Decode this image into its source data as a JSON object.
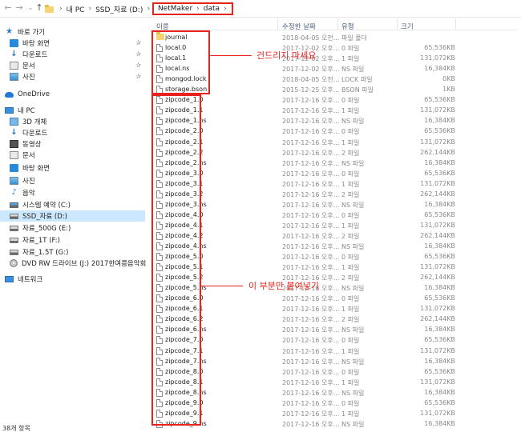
{
  "address_bar": {
    "back_icon": "back-arrow-icon",
    "forward_icon": "forward-arrow-icon",
    "up_icon": "up-arrow-icon",
    "crumbs": [
      "내 PC",
      "SSD_자료 (D:)",
      "NetMaker",
      "data"
    ]
  },
  "sidebar": {
    "items": [
      {
        "label": "바로 가기",
        "icon": "star-icon"
      },
      {
        "label": "바탕 화면",
        "icon": "desktop-icon",
        "pinned": true
      },
      {
        "label": "다운로드",
        "icon": "download-icon",
        "pinned": true
      },
      {
        "label": "문서",
        "icon": "document-icon",
        "pinned": true
      },
      {
        "label": "사진",
        "icon": "pictures-icon",
        "pinned": true
      },
      {
        "label": "OneDrive",
        "icon": "onedrive-icon"
      },
      {
        "label": "내 PC",
        "icon": "pc-icon"
      },
      {
        "label": "3D 개체",
        "icon": "3d-objects-icon"
      },
      {
        "label": "다운로드",
        "icon": "download-icon"
      },
      {
        "label": "동영상",
        "icon": "video-icon"
      },
      {
        "label": "문서",
        "icon": "document-icon"
      },
      {
        "label": "바탕 화면",
        "icon": "desktop-icon"
      },
      {
        "label": "사진",
        "icon": "pictures-icon"
      },
      {
        "label": "음악",
        "icon": "music-icon"
      },
      {
        "label": "시스템 예약 (C:)",
        "icon": "drive-icon"
      },
      {
        "label": "SSD_자료 (D:)",
        "icon": "drive-icon",
        "selected": true
      },
      {
        "label": "자료_500G (E:)",
        "icon": "drive-icon"
      },
      {
        "label": "자료_1T (F:)",
        "icon": "drive-icon"
      },
      {
        "label": "자료_1.5T (G:)",
        "icon": "drive-icon"
      },
      {
        "label": "DVD RW 드라이브 (J:) 2017한여름음악회",
        "icon": "dvd-icon"
      },
      {
        "label": "네트워크",
        "icon": "network-icon"
      }
    ]
  },
  "columns": {
    "name": "이름",
    "date": "수정한 날짜",
    "type": "유형",
    "size": "크기"
  },
  "files": [
    {
      "name": "journal",
      "date": "2018-04-05 오전...",
      "type": "파일 폴더",
      "size": "",
      "folder": true
    },
    {
      "name": "local.0",
      "date": "2017-12-02 오후...",
      "type": "0 파일",
      "size": "65,536KB"
    },
    {
      "name": "local.1",
      "date": "2017-12-02 오후...",
      "type": "1 파일",
      "size": "131,072KB"
    },
    {
      "name": "local.ns",
      "date": "2017-12-02 오후...",
      "type": "NS 파일",
      "size": "16,384KB"
    },
    {
      "name": "mongod.lock",
      "date": "2018-04-05 오전...",
      "type": "LOCK 파일",
      "size": "0KB"
    },
    {
      "name": "storage.bson",
      "date": "2015-12-25 오후...",
      "type": "BSON 파일",
      "size": "1KB"
    },
    {
      "name": "zipcode_1.0",
      "date": "2017-12-16 오후...",
      "type": "0 파일",
      "size": "65,536KB"
    },
    {
      "name": "zipcode_1.1",
      "date": "2017-12-16 오후...",
      "type": "1 파일",
      "size": "131,072KB"
    },
    {
      "name": "zipcode_1.ns",
      "date": "2017-12-16 오후...",
      "type": "NS 파일",
      "size": "16,384KB"
    },
    {
      "name": "zipcode_2.0",
      "date": "2017-12-16 오후...",
      "type": "0 파일",
      "size": "65,536KB"
    },
    {
      "name": "zipcode_2.1",
      "date": "2017-12-16 오후...",
      "type": "1 파일",
      "size": "131,072KB"
    },
    {
      "name": "zipcode_2.2",
      "date": "2017-12-16 오후...",
      "type": "2 파일",
      "size": "262,144KB"
    },
    {
      "name": "zipcode_2.ns",
      "date": "2017-12-16 오후...",
      "type": "NS 파일",
      "size": "16,384KB"
    },
    {
      "name": "zipcode_3.0",
      "date": "2017-12-16 오후...",
      "type": "0 파일",
      "size": "65,536KB"
    },
    {
      "name": "zipcode_3.1",
      "date": "2017-12-16 오후...",
      "type": "1 파일",
      "size": "131,072KB"
    },
    {
      "name": "zipcode_3.2",
      "date": "2017-12-16 오후...",
      "type": "2 파일",
      "size": "262,144KB"
    },
    {
      "name": "zipcode_3.ns",
      "date": "2017-12-16 오후...",
      "type": "NS 파일",
      "size": "16,384KB"
    },
    {
      "name": "zipcode_4.0",
      "date": "2017-12-16 오후...",
      "type": "0 파일",
      "size": "65,536KB"
    },
    {
      "name": "zipcode_4.1",
      "date": "2017-12-16 오후...",
      "type": "1 파일",
      "size": "131,072KB"
    },
    {
      "name": "zipcode_4.2",
      "date": "2017-12-16 오후...",
      "type": "2 파일",
      "size": "262,144KB"
    },
    {
      "name": "zipcode_4.ns",
      "date": "2017-12-16 오후...",
      "type": "NS 파일",
      "size": "16,384KB"
    },
    {
      "name": "zipcode_5.0",
      "date": "2017-12-16 오후...",
      "type": "0 파일",
      "size": "65,536KB"
    },
    {
      "name": "zipcode_5.1",
      "date": "2017-12-16 오후...",
      "type": "1 파일",
      "size": "131,072KB"
    },
    {
      "name": "zipcode_5.2",
      "date": "2017-12-16 오후...",
      "type": "2 파일",
      "size": "262,144KB"
    },
    {
      "name": "zipcode_5.ns",
      "date": "2017-12-16 오후...",
      "type": "NS 파일",
      "size": "16,384KB"
    },
    {
      "name": "zipcode_6.0",
      "date": "2017-12-16 오후...",
      "type": "0 파일",
      "size": "65,536KB"
    },
    {
      "name": "zipcode_6.1",
      "date": "2017-12-16 오후...",
      "type": "1 파일",
      "size": "131,072KB"
    },
    {
      "name": "zipcode_6.2",
      "date": "2017-12-16 오후...",
      "type": "2 파일",
      "size": "262,144KB"
    },
    {
      "name": "zipcode_6.ns",
      "date": "2017-12-16 오후...",
      "type": "NS 파일",
      "size": "16,384KB"
    },
    {
      "name": "zipcode_7.0",
      "date": "2017-12-16 오후...",
      "type": "0 파일",
      "size": "65,536KB"
    },
    {
      "name": "zipcode_7.1",
      "date": "2017-12-16 오후...",
      "type": "1 파일",
      "size": "131,072KB"
    },
    {
      "name": "zipcode_7.ns",
      "date": "2017-12-16 오후...",
      "type": "NS 파일",
      "size": "16,384KB"
    },
    {
      "name": "zipcode_8.0",
      "date": "2017-12-16 오후...",
      "type": "0 파일",
      "size": "65,536KB"
    },
    {
      "name": "zipcode_8.1",
      "date": "2017-12-16 오후...",
      "type": "1 파일",
      "size": "131,072KB"
    },
    {
      "name": "zipcode_8.ns",
      "date": "2017-12-16 오후...",
      "type": "NS 파일",
      "size": "16,384KB"
    },
    {
      "name": "zipcode_9.0",
      "date": "2017-12-16 오후...",
      "type": "0 파일",
      "size": "65,536KB"
    },
    {
      "name": "zipcode_9.1",
      "date": "2017-12-16 오후...",
      "type": "1 파일",
      "size": "131,072KB"
    },
    {
      "name": "zipcode_9.ns",
      "date": "2017-12-16 오후...",
      "type": "NS 파일",
      "size": "16,384KB"
    }
  ],
  "annotations": {
    "top_note": "건드리지 마세요",
    "bottom_note": "이 부분만 붙여넣기",
    "color": "#e8221d"
  },
  "status_bar": {
    "item_count": "38개 항목"
  }
}
